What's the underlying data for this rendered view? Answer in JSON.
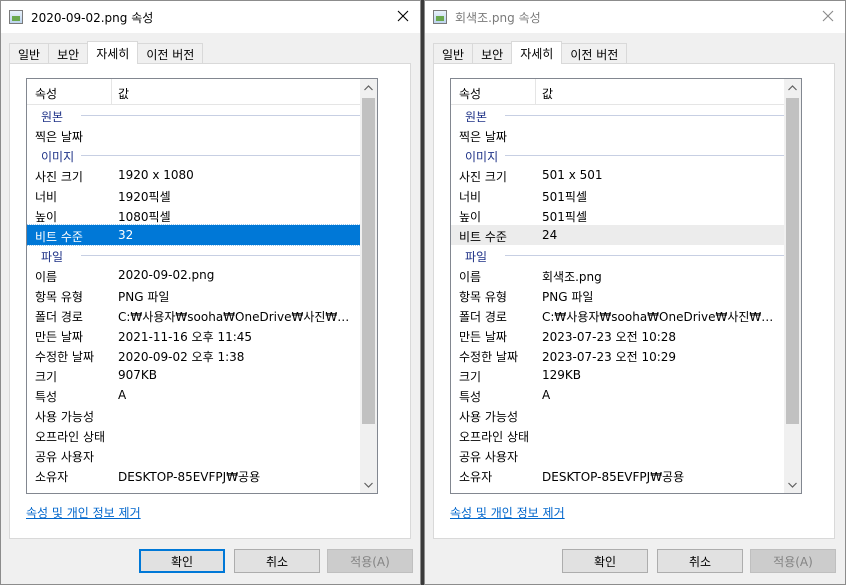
{
  "windows": [
    {
      "title": "2020-09-02.png 속성",
      "tabs": [
        {
          "label": "일반",
          "active": false
        },
        {
          "label": "보안",
          "active": false
        },
        {
          "label": "자세히",
          "active": true
        },
        {
          "label": "이전 버전",
          "active": false
        }
      ],
      "columns": {
        "property": "속성",
        "value": "값"
      },
      "rows": [
        {
          "group": "원본"
        },
        {
          "key": "찍은 날짜",
          "value": ""
        },
        {
          "group": "이미지"
        },
        {
          "key": "사진 크기",
          "value": "1920 x 1080"
        },
        {
          "key": "너비",
          "value": "1920픽셀"
        },
        {
          "key": "높이",
          "value": "1080픽셀"
        },
        {
          "key": "비트 수준",
          "value": "32",
          "selected": true
        },
        {
          "group": "파일"
        },
        {
          "key": "이름",
          "value": "2020-09-02.png"
        },
        {
          "key": "항목 유형",
          "value": "PNG 파일"
        },
        {
          "key": "폴더 경로",
          "value": "C:₩사용자₩sooha₩OneDrive₩사진₩스크..."
        },
        {
          "key": "만든 날짜",
          "value": "2021-11-16 오후 11:45"
        },
        {
          "key": "수정한 날짜",
          "value": "2020-09-02 오후 1:38"
        },
        {
          "key": "크기",
          "value": "907KB"
        },
        {
          "key": "특성",
          "value": "A"
        },
        {
          "key": "사용 가능성",
          "value": ""
        },
        {
          "key": "오프라인 상태",
          "value": ""
        },
        {
          "key": "공유 사용자",
          "value": ""
        },
        {
          "key": "소유자",
          "value": "DESKTOP-85EVFPJ₩공용"
        }
      ],
      "remove_link": "속성 및 개인 정보 제거",
      "buttons": {
        "ok": "확인",
        "cancel": "취소",
        "apply": "적용(A)"
      }
    },
    {
      "title": "회색조.png 속성",
      "tabs": [
        {
          "label": "일반",
          "active": false
        },
        {
          "label": "보안",
          "active": false
        },
        {
          "label": "자세히",
          "active": true
        },
        {
          "label": "이전 버전",
          "active": false
        }
      ],
      "columns": {
        "property": "속성",
        "value": "값"
      },
      "rows": [
        {
          "group": "원본"
        },
        {
          "key": "찍은 날짜",
          "value": ""
        },
        {
          "group": "이미지"
        },
        {
          "key": "사진 크기",
          "value": "501 x 501"
        },
        {
          "key": "너비",
          "value": "501픽셀"
        },
        {
          "key": "높이",
          "value": "501픽셀"
        },
        {
          "key": "비트 수준",
          "value": "24",
          "selected": true
        },
        {
          "group": "파일"
        },
        {
          "key": "이름",
          "value": "회색조.png"
        },
        {
          "key": "항목 유형",
          "value": "PNG 파일"
        },
        {
          "key": "폴더 경로",
          "value": "C:₩사용자₩sooha₩OneDrive₩사진₩스크..."
        },
        {
          "key": "만든 날짜",
          "value": "2023-07-23 오전 10:28"
        },
        {
          "key": "수정한 날짜",
          "value": "2023-07-23 오전 10:29"
        },
        {
          "key": "크기",
          "value": "129KB"
        },
        {
          "key": "특성",
          "value": "A"
        },
        {
          "key": "사용 가능성",
          "value": ""
        },
        {
          "key": "오프라인 상태",
          "value": ""
        },
        {
          "key": "공유 사용자",
          "value": ""
        },
        {
          "key": "소유자",
          "value": "DESKTOP-85EVFPJ₩공용"
        }
      ],
      "remove_link": "속성 및 개인 정보 제거",
      "buttons": {
        "ok": "확인",
        "cancel": "취소",
        "apply": "적용(A)"
      }
    }
  ],
  "colors": {
    "selection": "#0078d7",
    "link": "#0066cc",
    "group_text": "#1e3287"
  }
}
